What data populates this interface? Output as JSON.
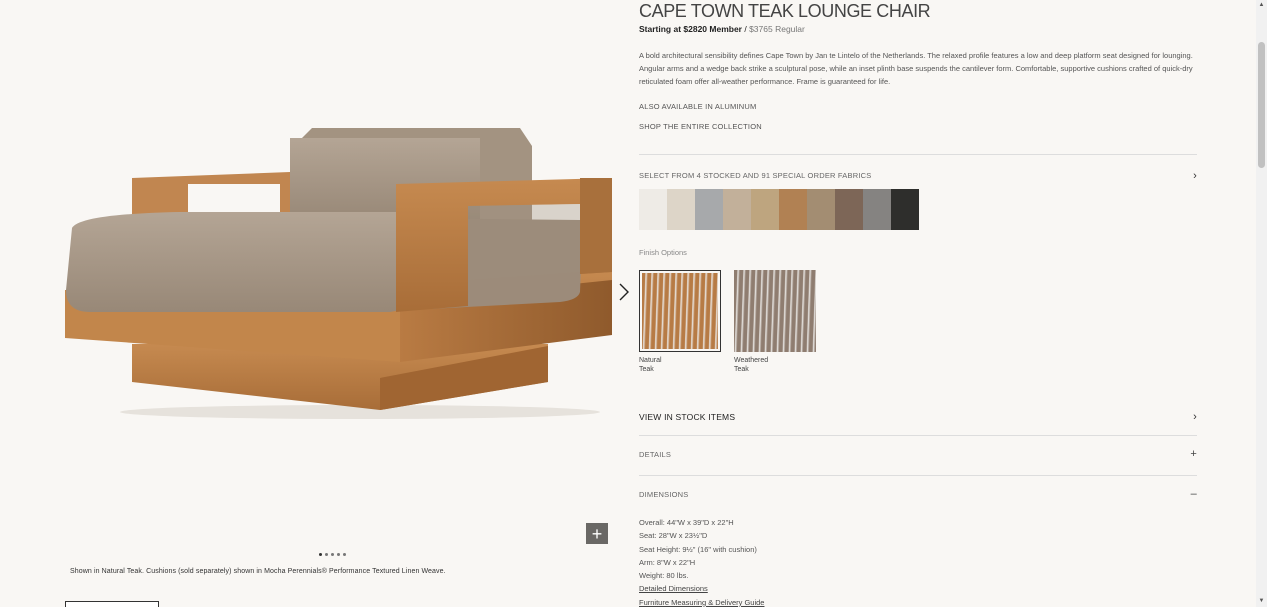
{
  "gallery": {
    "caption": "Shown in Natural Teak. Cushions (sold separately) shown in Mocha Perennials® Performance Textured Linen Weave.",
    "zoom_label": "+",
    "dot_count": 5,
    "active_dot": 0
  },
  "product": {
    "title": "CAPE TOWN TEAK LOUNGE CHAIR",
    "price_member": "Starting at $2820 Member",
    "price_separator": " / ",
    "price_regular": "$3765 Regular",
    "description": "A bold architectural sensibility defines Cape Town by Jan te Lintelo of the Netherlands. The relaxed profile features a low and deep platform seat designed for lounging. Angular arms and a wedge back strike a sculptural pose, while an inset plinth base suspends the cantilever form. Comfortable, supportive cushions crafted of quick-dry reticulated foam offer all-weather performance. Frame is guaranteed for life.",
    "also_available": "ALSO AVAILABLE IN ALUMINUM",
    "shop_collection": "SHOP THE ENTIRE COLLECTION"
  },
  "fabrics": {
    "heading": "SELECT FROM 4 STOCKED AND 91 SPECIAL ORDER FABRICS",
    "swatch_colors": [
      "#eeebe6",
      "#ddd5c8",
      "#a7a9ab",
      "#c2b09a",
      "#bea57f",
      "#b18153",
      "#a38d72",
      "#7d6657",
      "#858381",
      "#2e2e2c"
    ]
  },
  "finish": {
    "label": "Finish Options",
    "options": [
      {
        "name": "Natural Teak",
        "line1": "Natural",
        "line2": "Teak",
        "color": "#b77b45",
        "selected": true
      },
      {
        "name": "Weathered Teak",
        "line1": "Weathered",
        "line2": "Teak",
        "color": "#8f7d70",
        "selected": false
      }
    ]
  },
  "sections": {
    "in_stock": "VIEW IN STOCK ITEMS",
    "details": "DETAILS",
    "dimensions": "DIMENSIONS",
    "chevron": "›",
    "plus": "+",
    "minus": "–"
  },
  "dimensions": {
    "overall": "Overall: 44\"W x 39\"D x 22\"H",
    "seat": "Seat: 28\"W x 23½\"D",
    "seat_height": "Seat Height: 9½\" (16\" with cushion)",
    "arm": "Arm: 8\"W x 22\"H",
    "weight": "Weight: 80 lbs.",
    "detailed_link": "Detailed Dimensions",
    "guide_link": "Furniture Measuring & Delivery Guide"
  },
  "colors": {
    "background": "#f9f7f4",
    "teak": "#b77b45",
    "cushion": "#a89886"
  }
}
